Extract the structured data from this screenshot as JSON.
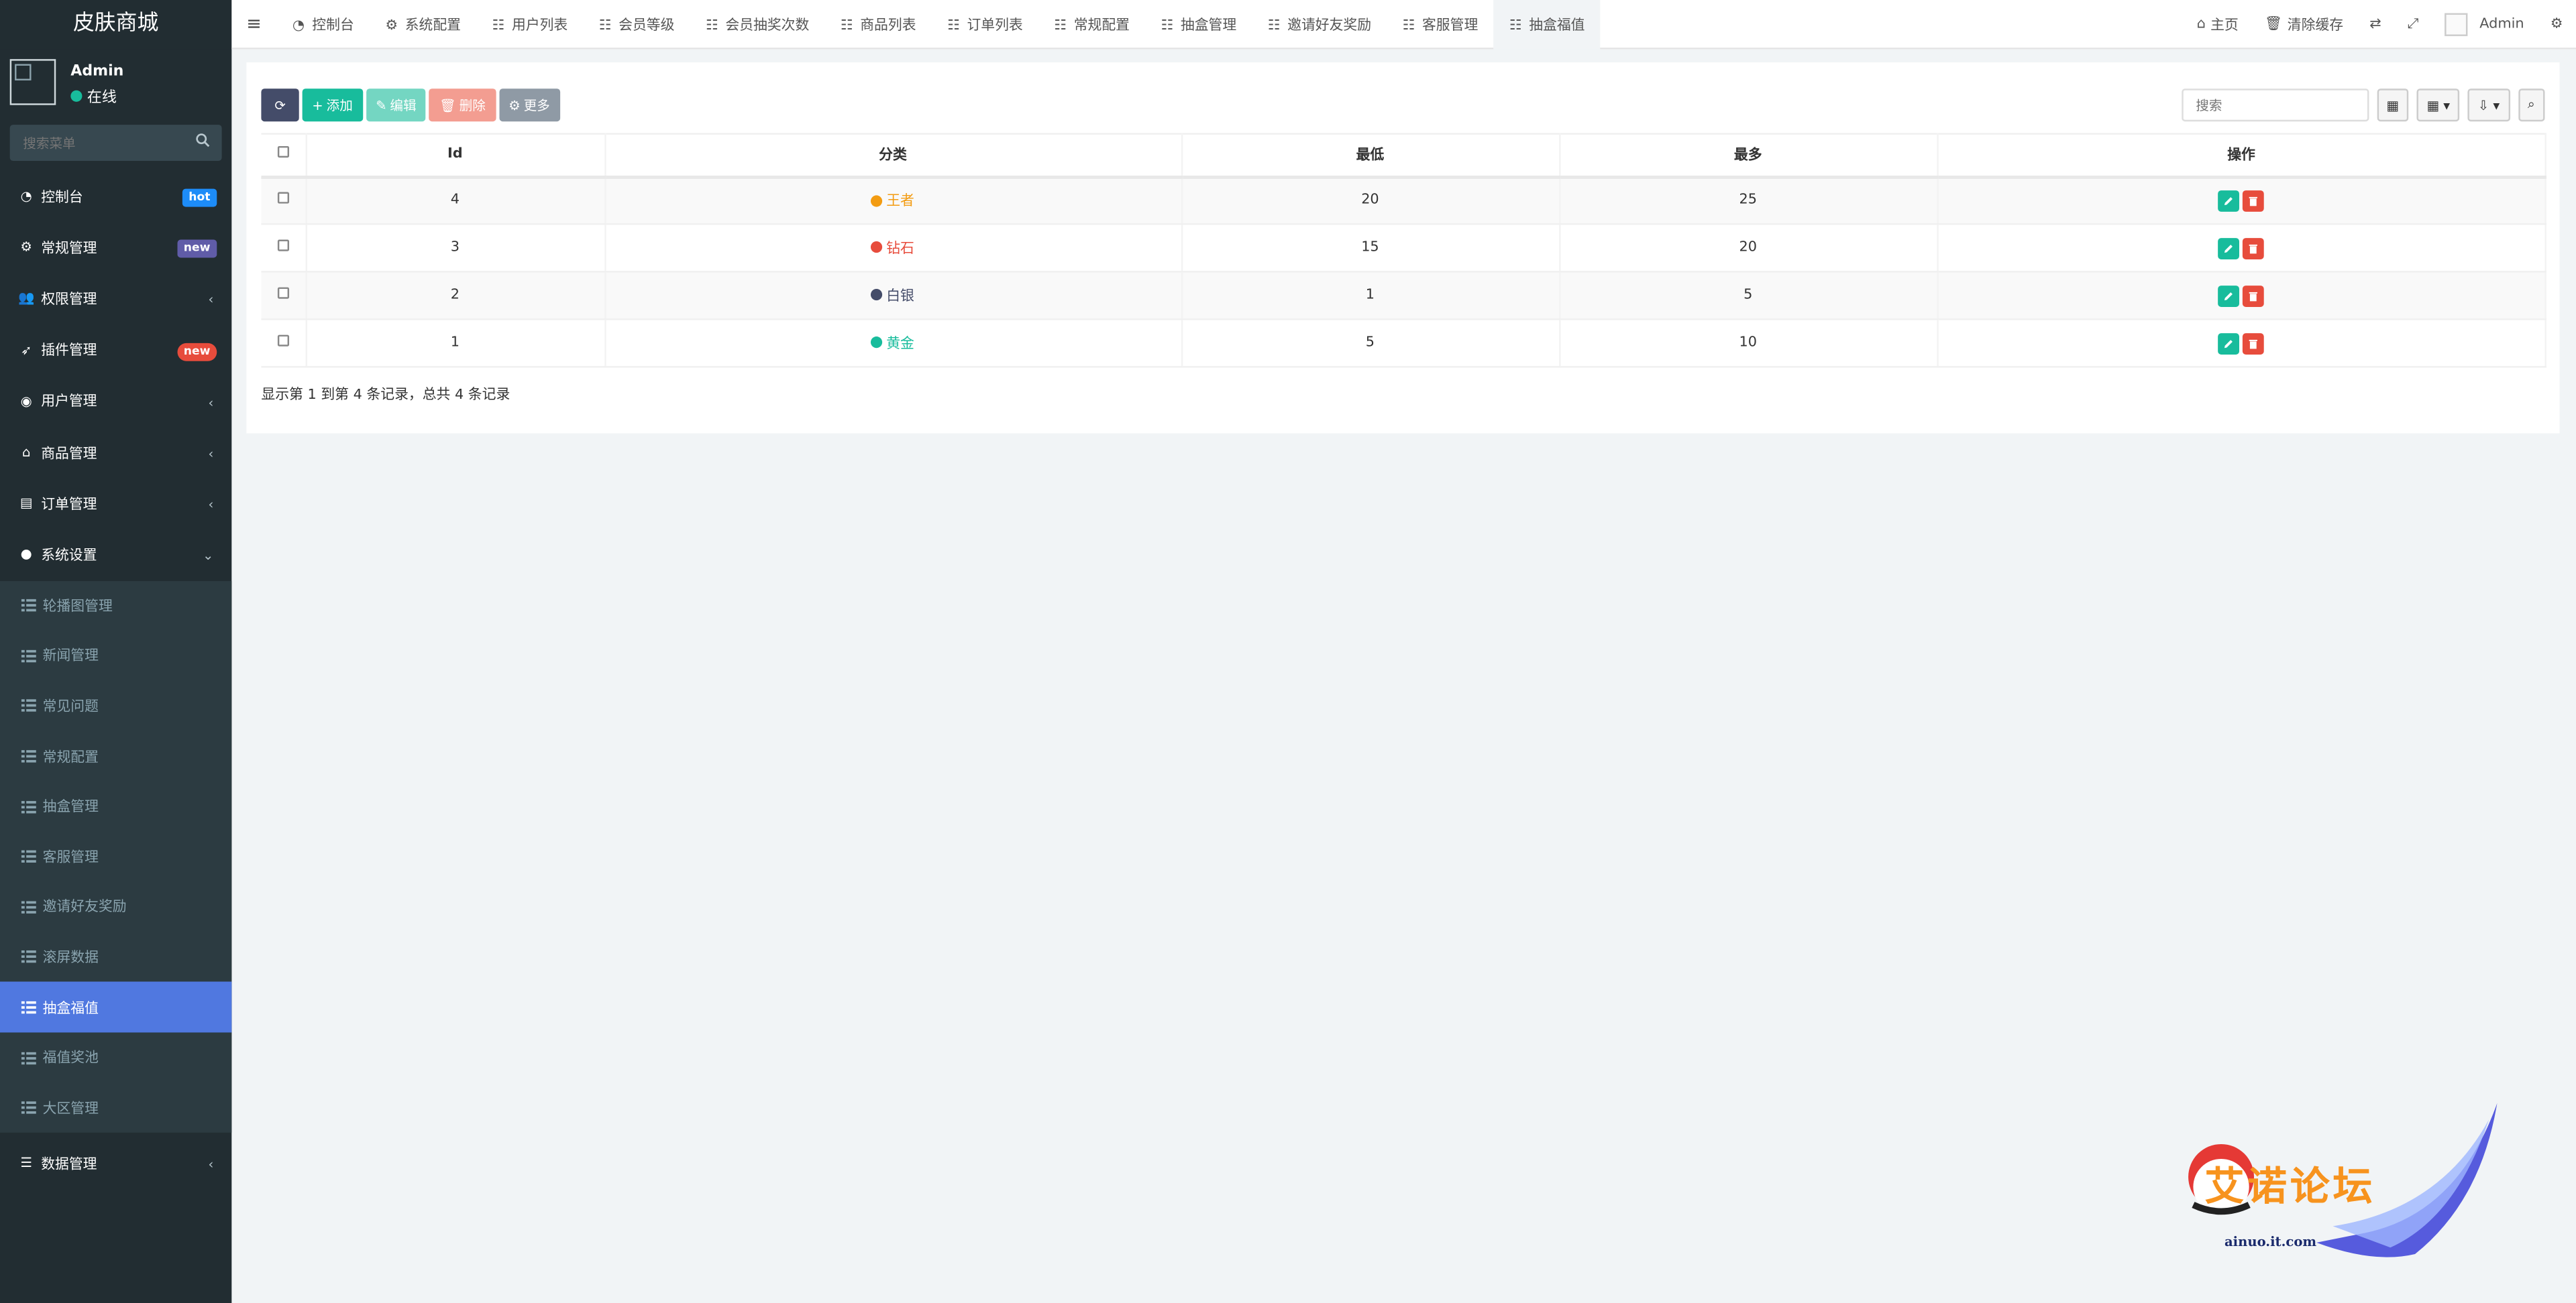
{
  "sidebar": {
    "logo": "皮肤商城",
    "user_name": "Admin",
    "user_status": "在线",
    "search_placeholder": "搜索菜单",
    "menu": [
      {
        "label": "控制台",
        "badge": "hot"
      },
      {
        "label": "常规管理",
        "badge": "new"
      },
      {
        "label": "权限管理"
      },
      {
        "label": "插件管理",
        "badge": "new"
      },
      {
        "label": "用户管理"
      },
      {
        "label": "商品管理"
      },
      {
        "label": "订单管理"
      },
      {
        "label": "系统设置"
      }
    ],
    "submenu": [
      "轮播图管理",
      "新闻管理",
      "常见问题",
      "常规配置",
      "抽盒管理",
      "客服管理",
      "邀请好友奖励",
      "滚屏数据",
      "抽盒福值",
      "福值奖池",
      "大区管理"
    ],
    "last_menu": "数据管理"
  },
  "topbar": {
    "tabs": [
      "控制台",
      "系统配置",
      "用户列表",
      "会员等级",
      "会员抽奖次数",
      "商品列表",
      "订单列表",
      "常规配置",
      "抽盒管理",
      "邀请好友奖励",
      "客服管理",
      "抽盒福值"
    ],
    "home": "主页",
    "clear_cache": "清除缓存",
    "admin": "Admin"
  },
  "toolbar": {
    "add": "添加",
    "edit": "编辑",
    "delete": "删除",
    "more": "更多",
    "search_placeholder": "搜索"
  },
  "table": {
    "headers": {
      "id": "Id",
      "category": "分类",
      "min": "最低",
      "max": "最多",
      "ops": "操作"
    },
    "rows": [
      {
        "id": "4",
        "category": "王者",
        "color": "#f39c12",
        "min": "20",
        "max": "25"
      },
      {
        "id": "3",
        "category": "钻石",
        "color": "#e74c3c",
        "min": "15",
        "max": "20"
      },
      {
        "id": "2",
        "category": "白银",
        "color": "#444c69",
        "min": "1",
        "max": "5"
      },
      {
        "id": "1",
        "category": "黄金",
        "color": "#18bc9c",
        "min": "5",
        "max": "10"
      }
    ]
  },
  "pager_text": "显示第 1 到第 4 条记录，总共 4 条记录",
  "watermark": {
    "logo_text": "艾诺论坛",
    "url": "ainuo.it.com"
  }
}
